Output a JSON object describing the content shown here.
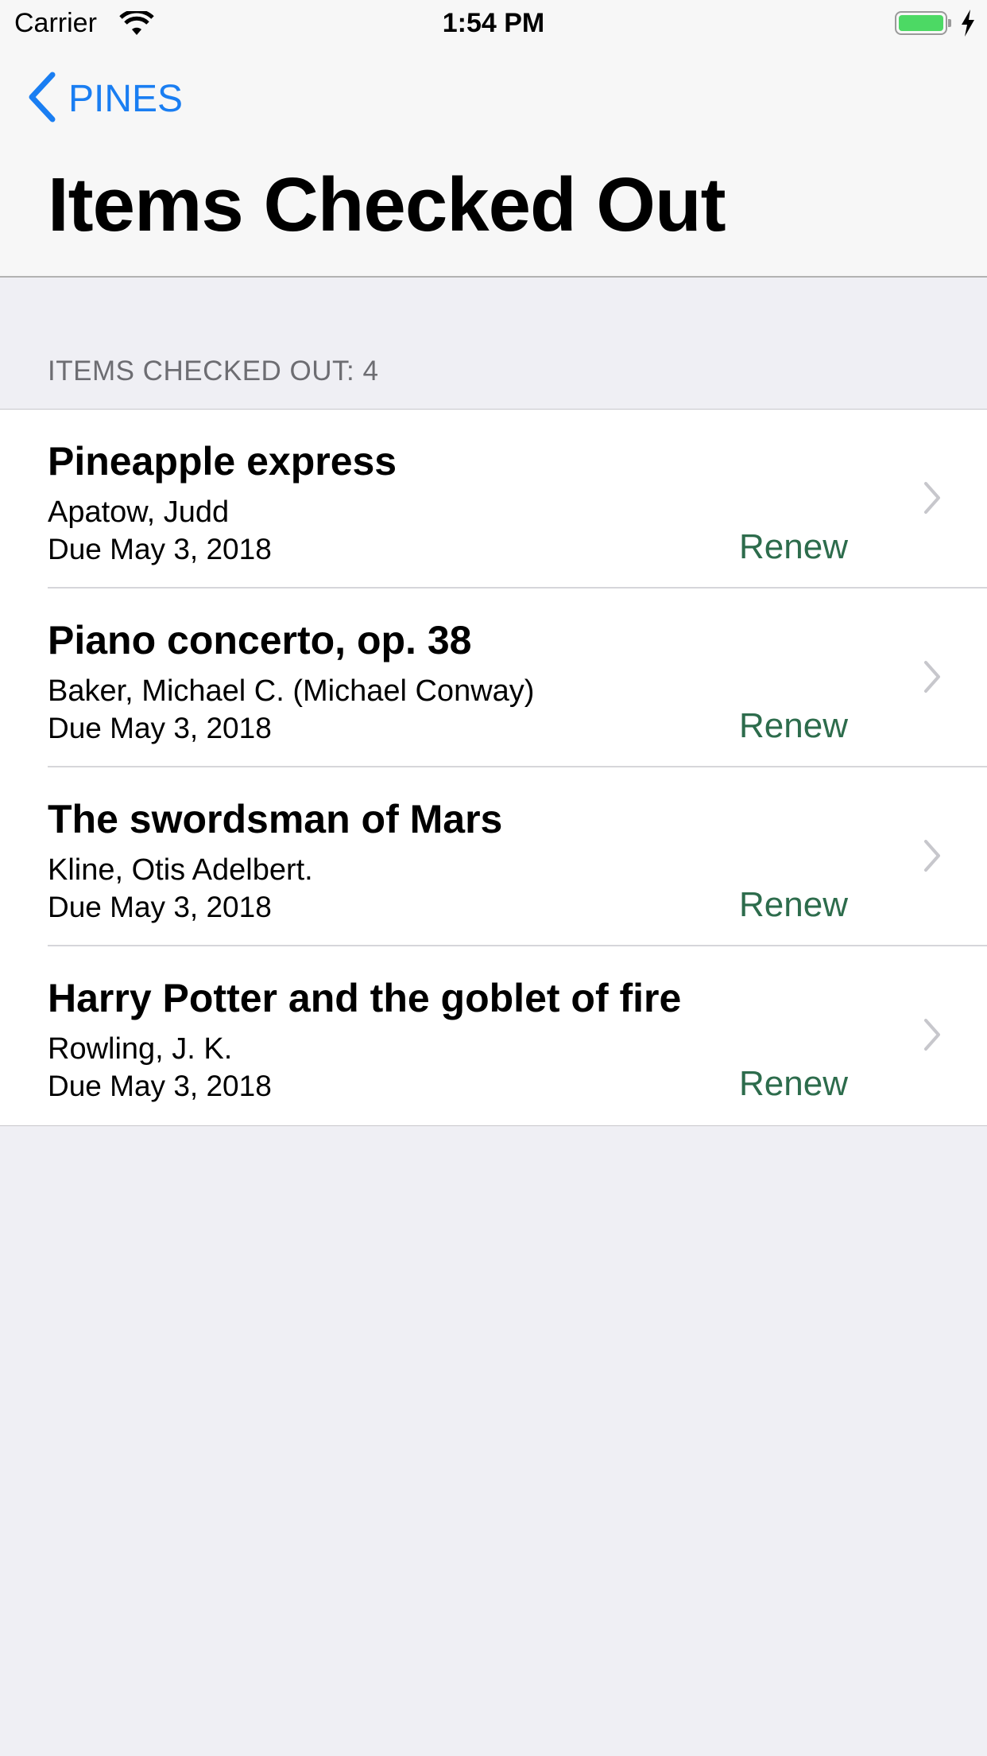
{
  "status_bar": {
    "carrier": "Carrier",
    "time": "1:54 PM",
    "battery_color": "#4cd964",
    "icons": [
      "wifi-icon",
      "battery-icon",
      "charging-bolt-icon"
    ]
  },
  "nav": {
    "back_label": "PINES",
    "title": "Items Checked Out",
    "accent_color": "#1a7ef2"
  },
  "section": {
    "header": "ITEMS CHECKED OUT: 4"
  },
  "items": [
    {
      "title": "Pineapple express",
      "author": "Apatow, Judd",
      "due": "Due May 3, 2018",
      "action": "Renew"
    },
    {
      "title": "Piano concerto, op. 38",
      "author": "Baker, Michael C. (Michael Conway)",
      "due": "Due May 3, 2018",
      "action": "Renew"
    },
    {
      "title": "The swordsman of Mars",
      "author": "Kline, Otis Adelbert.",
      "due": "Due May 3, 2018",
      "action": "Renew"
    },
    {
      "title": "Harry Potter and the goblet of fire",
      "author": "Rowling, J. K.",
      "due": "Due May 3, 2018",
      "action": "Renew"
    }
  ],
  "renew_color": "#2d6c4c"
}
